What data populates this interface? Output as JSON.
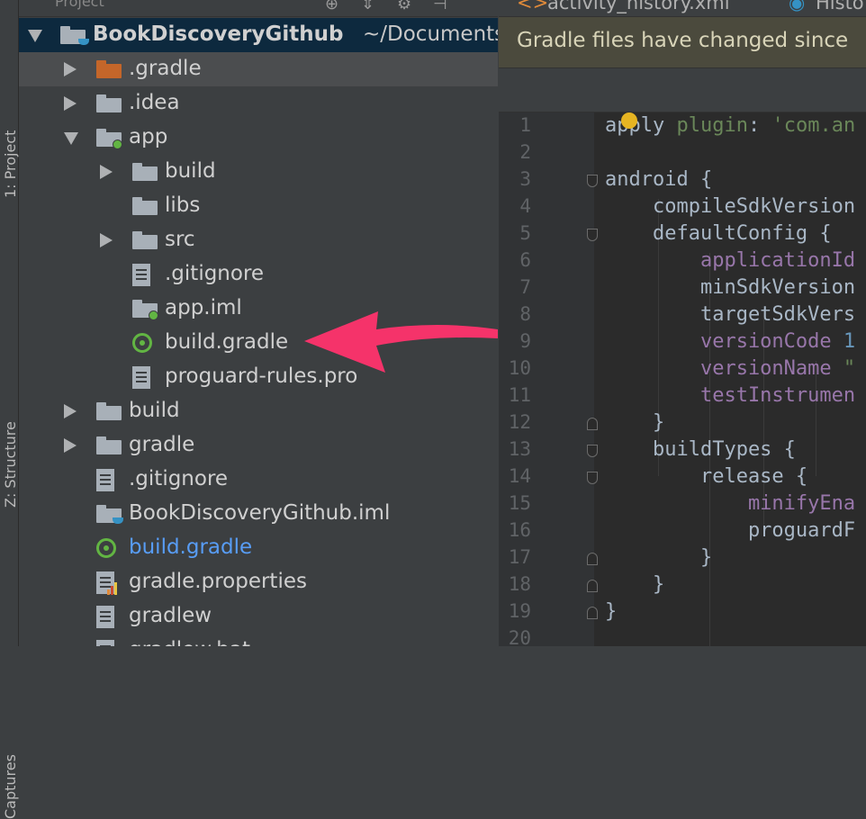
{
  "side_tabs": [
    {
      "label": "1: Project"
    },
    {
      "label": "Z: Structure"
    },
    {
      "label": "Captures"
    }
  ],
  "project_panel": {
    "header_label": "Project",
    "root": {
      "name": "BookDiscoveryGithub",
      "path": "~/Documents"
    },
    "tree": [
      {
        "label": ".gradle",
        "type": "folder-orange",
        "depth": 1,
        "arrow": "right"
      },
      {
        "label": ".idea",
        "type": "folder",
        "depth": 1,
        "arrow": "right"
      },
      {
        "label": "app",
        "type": "module",
        "depth": 1,
        "arrow": "down"
      },
      {
        "label": "build",
        "type": "folder",
        "depth": 2,
        "arrow": "right"
      },
      {
        "label": "libs",
        "type": "folder",
        "depth": 2,
        "arrow": "none"
      },
      {
        "label": "src",
        "type": "folder",
        "depth": 2,
        "arrow": "right"
      },
      {
        "label": ".gitignore",
        "type": "file",
        "depth": 2,
        "arrow": "none"
      },
      {
        "label": "app.iml",
        "type": "iml",
        "depth": 2,
        "arrow": "none"
      },
      {
        "label": "build.gradle",
        "type": "gradle",
        "depth": 2,
        "arrow": "none"
      },
      {
        "label": "proguard-rules.pro",
        "type": "file",
        "depth": 2,
        "arrow": "none"
      },
      {
        "label": "build",
        "type": "folder",
        "depth": 1,
        "arrow": "right"
      },
      {
        "label": "gradle",
        "type": "folder",
        "depth": 1,
        "arrow": "right"
      },
      {
        "label": ".gitignore",
        "type": "file",
        "depth": 1,
        "arrow": "none"
      },
      {
        "label": "BookDiscoveryGithub.iml",
        "type": "iml-blue",
        "depth": 1,
        "arrow": "none"
      },
      {
        "label": "build.gradle",
        "type": "gradle",
        "depth": 1,
        "arrow": "none",
        "highlight": true
      },
      {
        "label": "gradle.properties",
        "type": "properties",
        "depth": 1,
        "arrow": "none"
      },
      {
        "label": "gradlew",
        "type": "file",
        "depth": 1,
        "arrow": "none"
      },
      {
        "label": "gradlew.bat",
        "type": "file",
        "depth": 1,
        "arrow": "none"
      }
    ]
  },
  "editor": {
    "tabs": [
      {
        "label": "activity_history.xml"
      },
      {
        "label": "Histo"
      }
    ],
    "notice": "Gradle files have changed since",
    "line_numbers": [
      "1",
      "2",
      "3",
      "4",
      "5",
      "6",
      "7",
      "8",
      "9",
      "10",
      "11",
      "12",
      "13",
      "14",
      "15",
      "16",
      "17",
      "18",
      "19",
      "20"
    ],
    "code_lines": [
      [
        {
          "t": "apply ",
          "c": "plain"
        },
        {
          "t": "plugin",
          "c": "green"
        },
        {
          "t": ": ",
          "c": "plain"
        },
        {
          "t": "'com.an",
          "c": "green"
        }
      ],
      [],
      [
        {
          "t": "android {",
          "c": "plain"
        }
      ],
      [
        {
          "t": "    compileSdkVersion",
          "c": "plain"
        }
      ],
      [
        {
          "t": "    defaultConfig {",
          "c": "plain"
        }
      ],
      [
        {
          "t": "        applicationId",
          "c": "purple"
        }
      ],
      [
        {
          "t": "        minSdkVersion",
          "c": "plain"
        }
      ],
      [
        {
          "t": "        targetSdkVers",
          "c": "plain"
        }
      ],
      [
        {
          "t": "        versionCode ",
          "c": "purple"
        },
        {
          "t": "1",
          "c": "num"
        }
      ],
      [
        {
          "t": "        versionName ",
          "c": "purple"
        },
        {
          "t": "\"",
          "c": "green"
        }
      ],
      [
        {
          "t": "        testInstrumen",
          "c": "purple"
        }
      ],
      [
        {
          "t": "    }",
          "c": "plain"
        }
      ],
      [
        {
          "t": "    buildTypes {",
          "c": "plain"
        }
      ],
      [
        {
          "t": "        release {",
          "c": "plain"
        }
      ],
      [
        {
          "t": "            minifyEna",
          "c": "purple"
        }
      ],
      [
        {
          "t": "            proguardF",
          "c": "plain"
        }
      ],
      [
        {
          "t": "        }",
          "c": "plain"
        }
      ],
      [
        {
          "t": "    }",
          "c": "plain"
        }
      ],
      [
        {
          "t": "}",
          "c": "plain"
        }
      ],
      []
    ]
  },
  "colors": {
    "accent_arrow": "#f5336a",
    "selection": "#0d293e",
    "highlight_link": "#589df6"
  }
}
